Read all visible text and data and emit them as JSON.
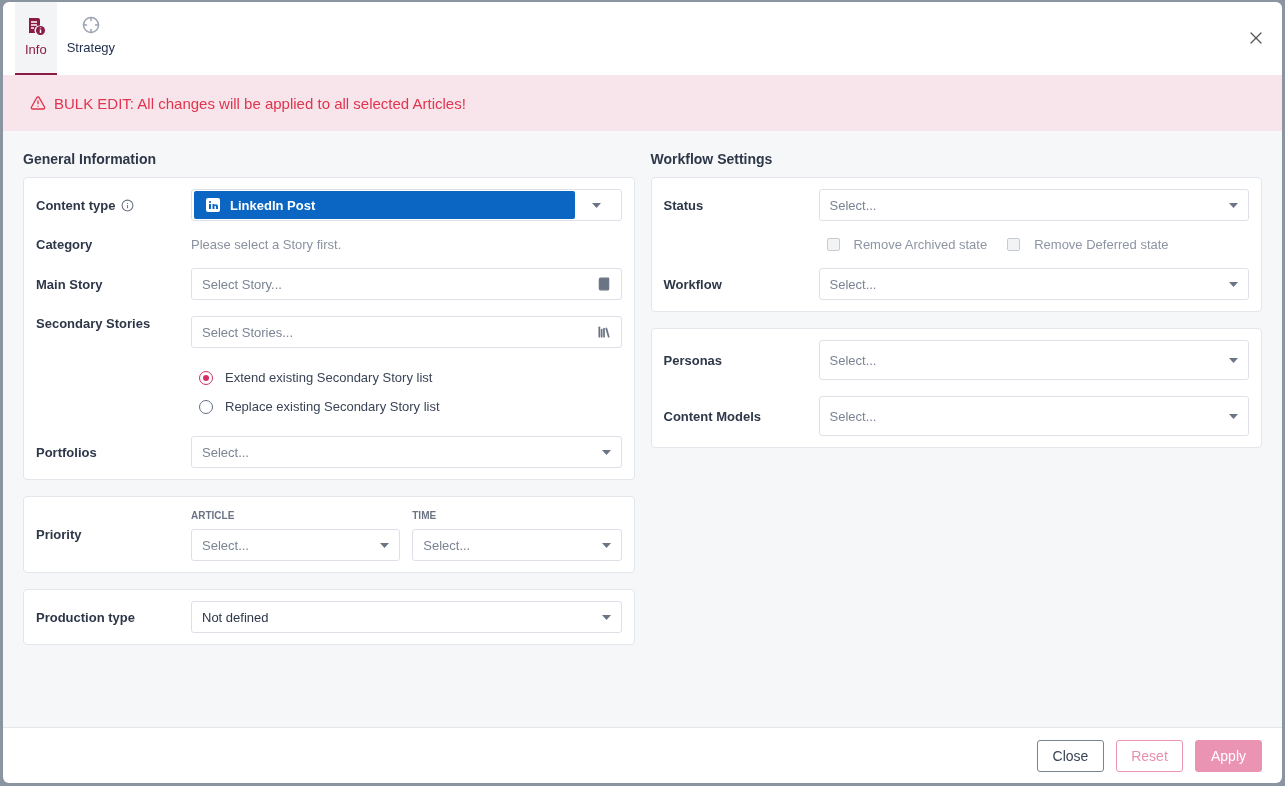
{
  "tabs": [
    {
      "label": "Info",
      "selected": true
    },
    {
      "label": "Strategy",
      "selected": false
    }
  ],
  "banner": {
    "text": "BULK EDIT: All changes will be applied to all selected Articles!"
  },
  "columns": [
    {
      "title": "General Information",
      "cards": [
        {
          "fields": [
            {
              "kind": "badge_select",
              "label": "Content type",
              "value": "LinkedIn Post"
            },
            {
              "kind": "note",
              "label": "Category",
              "text": "Please select a Story first."
            },
            {
              "kind": "single_lookup",
              "label": "Main Story",
              "placeholder": "Select Story..."
            },
            {
              "kind": "multi_lookup",
              "label": "Secondary Stories",
              "placeholder": "Select Stories..."
            },
            {
              "kind": "radios",
              "options": [
                {
                  "label": "Extend existing Secondary Story list",
                  "selected": true
                },
                {
                  "label": "Replace existing Secondary Story list",
                  "selected": false
                }
              ]
            },
            {
              "kind": "select",
              "label": "Portfolios",
              "placeholder": "Select..."
            }
          ]
        },
        {
          "fields": [
            {
              "kind": "split_select",
              "label": "Priority",
              "parts": [
                {
                  "caption": "ARTICLE",
                  "placeholder": "Select..."
                },
                {
                  "caption": "TIME",
                  "placeholder": "Select..."
                }
              ]
            }
          ]
        },
        {
          "fields": [
            {
              "kind": "select",
              "label": "Production type",
              "value": "Not defined"
            }
          ]
        }
      ]
    },
    {
      "title": "Workflow Settings",
      "cards": [
        {
          "fields": [
            {
              "kind": "select",
              "label": "Status",
              "placeholder": "Select..."
            },
            {
              "kind": "checks",
              "options": [
                {
                  "label": "Remove Archived state",
                  "checked": false,
                  "disabled": true
                },
                {
                  "label": "Remove Deferred state",
                  "checked": false,
                  "disabled": true
                }
              ]
            },
            {
              "kind": "select",
              "label": "Workflow",
              "placeholder": "Select..."
            }
          ]
        },
        {
          "fields": [
            {
              "kind": "tall_select",
              "label": "Personas",
              "placeholder": "Select..."
            },
            {
              "kind": "tall_select",
              "label": "Content Models",
              "placeholder": "Select..."
            }
          ]
        }
      ]
    }
  ],
  "buttons": [
    {
      "label": "Close",
      "kind": "secondary",
      "disabled": false
    },
    {
      "label": "Reset",
      "kind": "outline",
      "disabled": true
    },
    {
      "label": "Apply",
      "kind": "primary",
      "disabled": true
    }
  ]
}
